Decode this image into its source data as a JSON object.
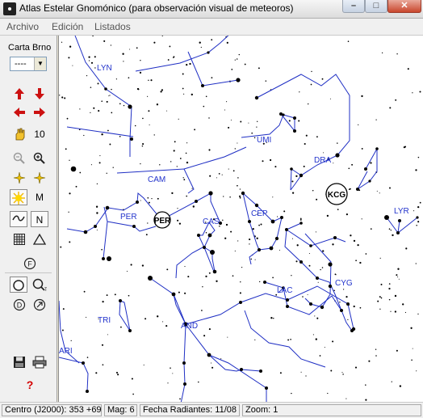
{
  "window": {
    "title": "Atlas Estelar Gnomónico (para observación visual de meteoros)"
  },
  "menu": {
    "items": [
      "Archivo",
      "Edición",
      "Listados"
    ]
  },
  "toolbar": {
    "carta_label": "Carta Brno",
    "carta_value": "----",
    "step_value": "10",
    "m_label": "M",
    "n_label": "N",
    "help_label": "?"
  },
  "chart": {
    "constellations": [
      "LYN",
      "UMI",
      "CAM",
      "DRA",
      "PER",
      "CAS",
      "CEP",
      "LYR",
      "CYG",
      "LAC",
      "TRI",
      "AND",
      "ARI"
    ],
    "radiants": [
      "PER",
      "KCG"
    ]
  },
  "status": {
    "centro": "Centro (J2000): 353 +69",
    "mag": "Mag: 6",
    "fecha": "Fecha Radiantes: 11/08",
    "zoom": "Zoom: 1"
  },
  "colors": {
    "constellation_lines": "#1f2fc4",
    "label": "#2233cc",
    "help": "#d40000",
    "arrow": "#cc1111"
  }
}
